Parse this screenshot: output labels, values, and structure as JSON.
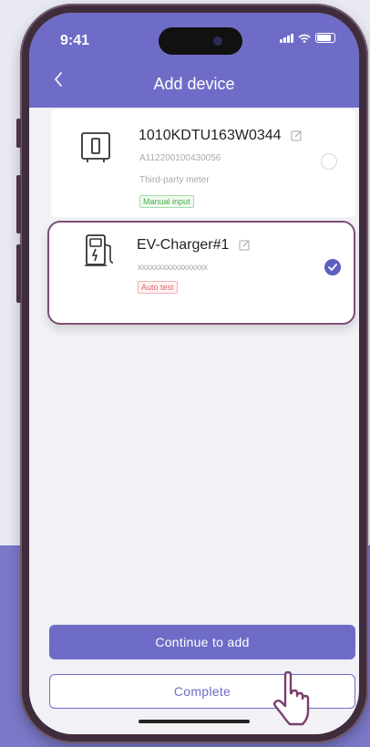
{
  "status_bar": {
    "time": "9:41"
  },
  "header": {
    "back_icon": "chevron-left-icon",
    "title": "Add device"
  },
  "devices": [
    {
      "name": "1010KDTU163W0344",
      "serial": "A112200100430056",
      "type": "Third-party meter",
      "tag": "Manual input",
      "selected": false,
      "icon": "meter-icon"
    },
    {
      "name": "EV-Charger#1",
      "serial": "xxxxxxxxxxxxxxxxx",
      "tag": "Auto test",
      "selected": true,
      "icon": "ev-charger-icon"
    }
  ],
  "actions": {
    "continue_label": "Continue to add",
    "complete_label": "Complete"
  },
  "colors": {
    "accent": "#6f6cc7",
    "highlight_border": "#7c4f76",
    "tag_green": "#4caa4c",
    "tag_red": "#e0626a"
  }
}
